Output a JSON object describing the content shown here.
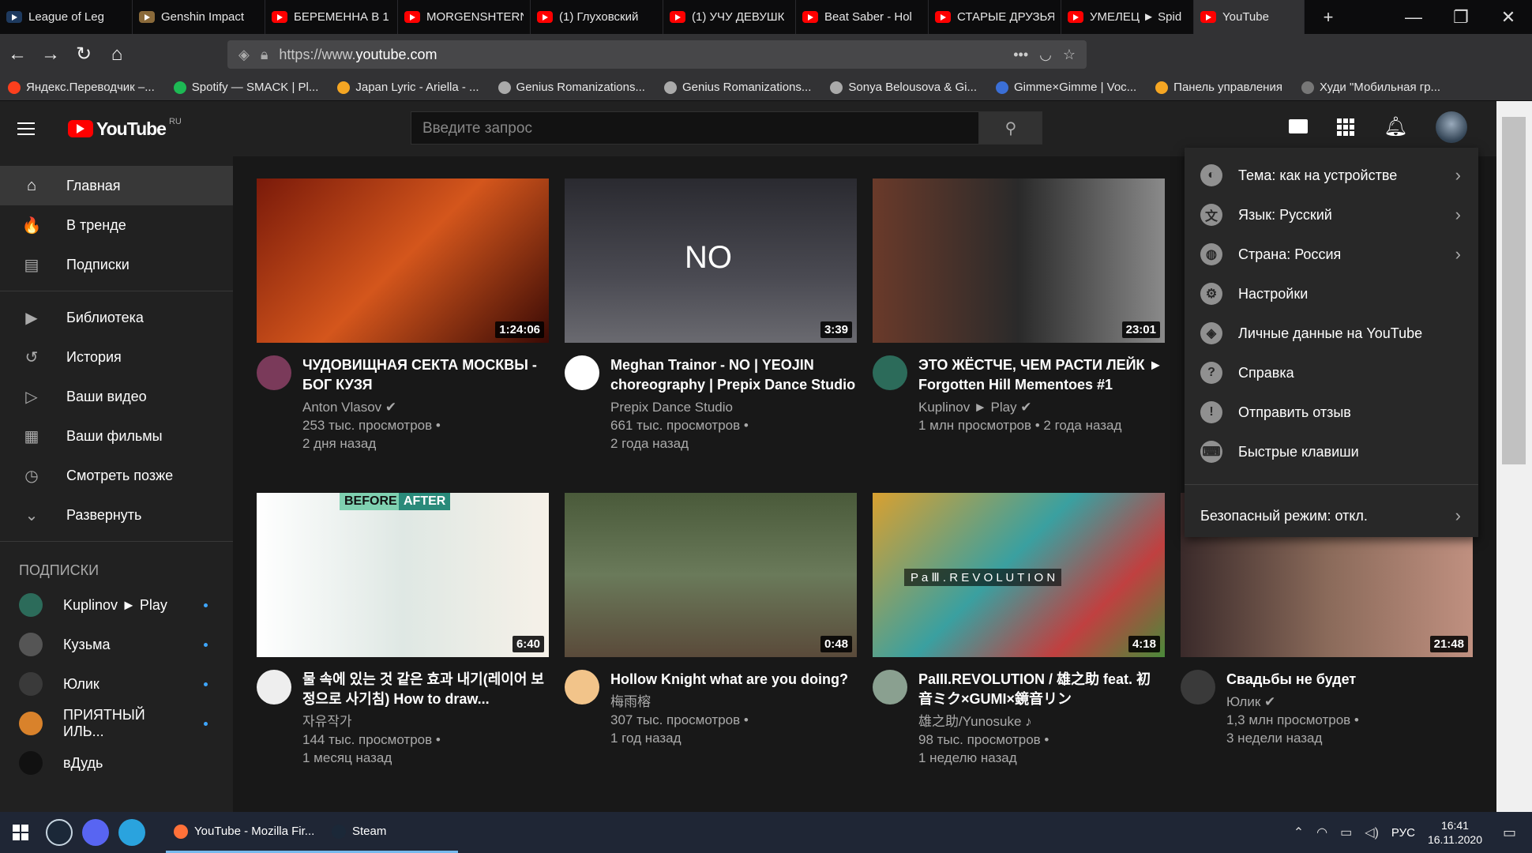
{
  "browser": {
    "tabs": [
      {
        "title": "League of Leg",
        "color": "#1e3a5f"
      },
      {
        "title": "Genshin Impact",
        "color": "#8a6a3a"
      },
      {
        "title": "БЕРЕМЕННА В 1",
        "color": "#ff0000"
      },
      {
        "title": "MORGENSHTERN",
        "color": "#ff0000"
      },
      {
        "title": "(1) Глуховский",
        "color": "#ff0000"
      },
      {
        "title": "(1) УЧУ ДЕВУШК",
        "color": "#ff0000"
      },
      {
        "title": "Beat Saber - Hol",
        "color": "#ff0000"
      },
      {
        "title": "СТАРЫЕ ДРУЗЬЯ",
        "color": "#ff0000"
      },
      {
        "title": "УМЕЛЕЦ ► Spid",
        "color": "#ff0000"
      },
      {
        "title": "YouTube",
        "color": "#ff0000"
      }
    ],
    "new_tab": "+",
    "window_min": "—",
    "window_max": "❐",
    "window_close": "✕",
    "url_scheme": "https://www.",
    "url_host": "youtube.com",
    "bookmarks": [
      {
        "label": "Яндекс.Переводчик –...",
        "color": "#fc3f1d"
      },
      {
        "label": "Spotify — SMACK | Pl...",
        "color": "#1db954"
      },
      {
        "label": "Japan Lyric - Ariella - ...",
        "color": "#f5a623"
      },
      {
        "label": "Genius Romanizations...",
        "color": "#aaaaaa"
      },
      {
        "label": "Genius Romanizations...",
        "color": "#aaaaaa"
      },
      {
        "label": "Sonya Belousova & Gi...",
        "color": "#aaaaaa"
      },
      {
        "label": "Gimme×Gimme | Voc...",
        "color": "#3b6fd6"
      },
      {
        "label": "Панель управления",
        "color": "#f5a623"
      },
      {
        "label": "Худи \"Мобильная гр...",
        "color": "#777777"
      }
    ]
  },
  "yt": {
    "logo": "YouTube",
    "logo_region": "RU",
    "search_placeholder": "Введите запрос",
    "sidebar_main": [
      {
        "label": "Главная",
        "icon": "home-icon",
        "glyph": "⌂"
      },
      {
        "label": "В тренде",
        "icon": "fire-icon",
        "glyph": "🔥"
      },
      {
        "label": "Подписки",
        "icon": "subscriptions-icon",
        "glyph": "▤"
      }
    ],
    "sidebar_library": [
      {
        "label": "Библиотека",
        "icon": "library-icon",
        "glyph": "▶"
      },
      {
        "label": "История",
        "icon": "history-icon",
        "glyph": "↺"
      },
      {
        "label": "Ваши видео",
        "icon": "your-videos-icon",
        "glyph": "▷"
      },
      {
        "label": "Ваши фильмы",
        "icon": "movies-icon",
        "glyph": "▦"
      },
      {
        "label": "Смотреть позже",
        "icon": "clock-icon",
        "glyph": "◷"
      },
      {
        "label": "Развернуть",
        "icon": "chevron-down-icon",
        "glyph": "⌄"
      }
    ],
    "subs_heading": "ПОДПИСКИ",
    "subscriptions": [
      {
        "name": "Kuplinov ► Play",
        "color": "#2c6b5a"
      },
      {
        "name": "Кузьма",
        "color": "#555555"
      },
      {
        "name": "Юлик",
        "color": "#3a3a3a"
      },
      {
        "name": "ПРИЯТНЫЙ ИЛЬ...",
        "color": "#d9822b"
      },
      {
        "name": "вДудь",
        "color": "#111111"
      }
    ],
    "videos": [
      {
        "title": "ЧУДОВИЩНАЯ СЕКТА МОСКВЫ - БОГ КУЗЯ",
        "channel": "Anton Vlasov ✔",
        "views": "253 тыс. просмотров •",
        "age": "2 дня назад",
        "duration": "1:24:06",
        "thumb": "linear-gradient(135deg,#7a1a0a,#d4561c 50%,#3a0a05)",
        "avatar": "#7a3a5a"
      },
      {
        "title": "Meghan Trainor - NO | YEOJIN choreography | Prepix Dance Studio",
        "channel": "Prepix Dance Studio",
        "views": "661 тыс. просмотров •",
        "age": "2 года назад",
        "duration": "3:39",
        "thumb": "linear-gradient(180deg,#2a2a30,#4a4a52 60%,#6a6a70)",
        "avatar": "#ffffff"
      },
      {
        "title": "ЭТО ЖЁСТЧЕ, ЧЕМ РАСТИ ЛЕЙК ► Forgotten Hill Mementoes #1",
        "channel": "Kuplinov ► Play ✔",
        "views": "1 млн просмотров • 2 года назад",
        "age": "",
        "duration": "23:01",
        "thumb": "linear-gradient(90deg,#6a3a2a,#2a2a2a 50%,#8a8a8a)",
        "avatar": "#2c6b5a"
      },
      {
        "title": "물 속에 있는 것 같은 효과 내기(레이어 보정으로 사기침) How to draw...",
        "channel": "자유작가",
        "views": "144 тыс. просмотров •",
        "age": "1 месяц назад",
        "duration": "6:40",
        "thumb": "linear-gradient(90deg,#ffffff,#dfe8e4 50%,#f6f1e8)",
        "avatar": "#eeeeee"
      },
      {
        "title": "Hollow Knight what are you doing?",
        "channel": "梅雨榕",
        "views": "307 тыс. просмотров •",
        "age": "1 год назад",
        "duration": "0:48",
        "thumb": "linear-gradient(180deg,#4a5a3a,#6a7a5a 50%,#5a4a3a)",
        "avatar": "#f2c48a"
      },
      {
        "title": "PaIII.REVOLUTION / 雄之助 feat. 初音ミク×GUMI×鏡音リン",
        "channel": "雄之助/Yunosuke ♪",
        "views": "98 тыс. просмотров •",
        "age": "1 неделю назад",
        "duration": "4:18",
        "thumb": "linear-gradient(135deg,#d9a030,#3aa0a0 45%,#c04040 75%,#4a8a3a)",
        "avatar": "#8aa090"
      },
      {
        "title": "Свадьбы не будет",
        "channel": "Юлик ✔",
        "views": "1,3 млн просмотров •",
        "age": "3 недели назад",
        "duration": "21:48",
        "thumb": "linear-gradient(90deg,#3a2a2a,#8a6a5a 50%,#c09080)",
        "avatar": "#3a3a3a"
      }
    ],
    "thumb_overlays": {
      "no_text": "NO",
      "before": "BEFORE",
      "after": "AFTER",
      "revolution": "P a Ⅲ . R E V O L U T I O N"
    },
    "menu": [
      {
        "label": "Тема: как на устройстве",
        "icon": "theme-icon",
        "glyph": "◐",
        "chevron": true
      },
      {
        "label": "Язык: Русский",
        "icon": "language-icon",
        "glyph": "文",
        "chevron": true
      },
      {
        "label": "Страна: Россия",
        "icon": "globe-icon",
        "glyph": "◍",
        "chevron": true
      },
      {
        "label": "Настройки",
        "icon": "gear-icon",
        "glyph": "⚙",
        "chevron": false
      },
      {
        "label": "Личные данные на YouTube",
        "icon": "shield-icon",
        "glyph": "◈",
        "chevron": false
      },
      {
        "label": "Справка",
        "icon": "help-icon",
        "glyph": "?",
        "chevron": false
      },
      {
        "label": "Отправить отзыв",
        "icon": "feedback-icon",
        "glyph": "!",
        "chevron": false
      },
      {
        "label": "Быстрые клавиши",
        "icon": "keyboard-icon",
        "glyph": "⌨",
        "chevron": false
      }
    ],
    "safe_mode": "Безопасный режим: откл."
  },
  "taskbar": {
    "apps": [
      {
        "label": "YouTube - Mozilla Fir...",
        "color": "#ff7139"
      },
      {
        "label": "Steam",
        "color": "#1b2838"
      }
    ],
    "lang": "РУС",
    "time": "16:41",
    "date": "16.11.2020"
  }
}
